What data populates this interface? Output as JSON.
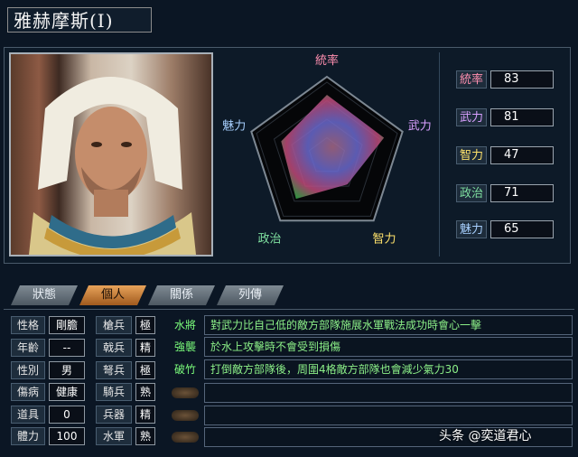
{
  "title": "雅赫摩斯(Ⅰ)",
  "radar": {
    "labels": {
      "tongshuai": "統率",
      "wuli": "武力",
      "zhili": "智力",
      "zhengzhi": "政治",
      "meili": "魅力"
    },
    "values": {
      "tongshuai": 83,
      "wuli": 81,
      "zhili": 47,
      "zhengzhi": 71,
      "meili": 65
    },
    "max": 100,
    "label_colors": {
      "tongshuai": "#ff8fb0",
      "wuli": "#d9a0ff",
      "zhili": "#ffe36b",
      "zhengzhi": "#7fe0a0",
      "meili": "#a8d0ff"
    }
  },
  "stats": [
    {
      "label": "統率",
      "value": "83",
      "color": "#ff8fb0"
    },
    {
      "label": "武力",
      "value": "81",
      "color": "#d9a0ff"
    },
    {
      "label": "智力",
      "value": "47",
      "color": "#ffe36b"
    },
    {
      "label": "政治",
      "value": "71",
      "color": "#7fe0a0"
    },
    {
      "label": "魅力",
      "value": "65",
      "color": "#a8d0ff"
    }
  ],
  "tabs": [
    "狀態",
    "個人",
    "關係",
    "列傳"
  ],
  "personal": [
    {
      "label": "性格",
      "value": "剛膽"
    },
    {
      "label": "年齡",
      "value": "--"
    },
    {
      "label": "性別",
      "value": "男"
    },
    {
      "label": "傷病",
      "value": "健康"
    },
    {
      "label": "道具",
      "value": "0"
    },
    {
      "label": "體力",
      "value": "100"
    }
  ],
  "aptitudes": [
    {
      "label": "槍兵",
      "value": "極"
    },
    {
      "label": "戟兵",
      "value": "精"
    },
    {
      "label": "弩兵",
      "value": "極"
    },
    {
      "label": "騎兵",
      "value": "熟"
    },
    {
      "label": "兵器",
      "value": "精"
    },
    {
      "label": "水軍",
      "value": "熟"
    }
  ],
  "skills": [
    {
      "name": "水將",
      "desc": "對武力比自己低的敵方部隊施展水軍戰法成功時會心一擊"
    },
    {
      "name": "強襲",
      "desc": "於水上攻擊時不會受到損傷"
    },
    {
      "name": "破竹",
      "desc": "打倒敵方部隊後，周圍4格敵方部隊也會減少氣力30"
    }
  ],
  "watermark": "头条 @奕道君心"
}
